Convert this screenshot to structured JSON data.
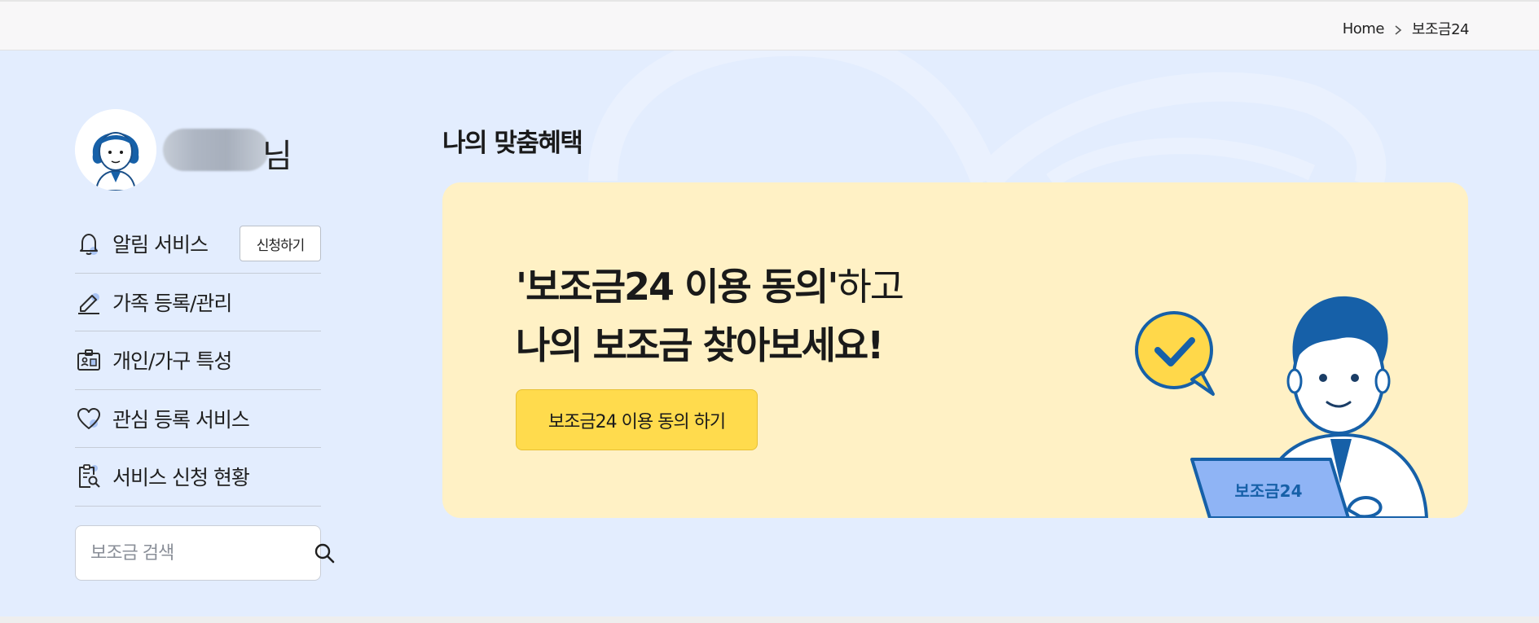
{
  "breadcrumb": {
    "home": "Home",
    "current": "보조금24"
  },
  "profile": {
    "name_suffix": "님"
  },
  "sidebar": {
    "items": [
      {
        "label": "알림 서비스",
        "icon": "bell-icon",
        "button": "신청하기"
      },
      {
        "label": "가족 등록/관리",
        "icon": "pencil-icon"
      },
      {
        "label": "개인/가구 특성",
        "icon": "id-card-icon"
      },
      {
        "label": "관심 등록 서비스",
        "icon": "heart-icon"
      },
      {
        "label": "서비스 신청 현황",
        "icon": "clipboard-search-icon"
      }
    ],
    "search": {
      "placeholder": "보조금 검색",
      "icon": "search-icon"
    }
  },
  "main": {
    "title": "나의 맞춤혜택",
    "banner": {
      "line1_strong": "'보조금24 이용 동의'",
      "line1_rest": "하고",
      "line2": "나의 보조금 찾아보세요!",
      "cta": "보조금24 이용 동의 하기",
      "laptop_text": "보조금24"
    }
  },
  "colors": {
    "page_bg": "#e3edfe",
    "banner_bg": "#fff1c5",
    "cta_bg": "#ffdb4d",
    "brand_blue": "#1660a8"
  }
}
